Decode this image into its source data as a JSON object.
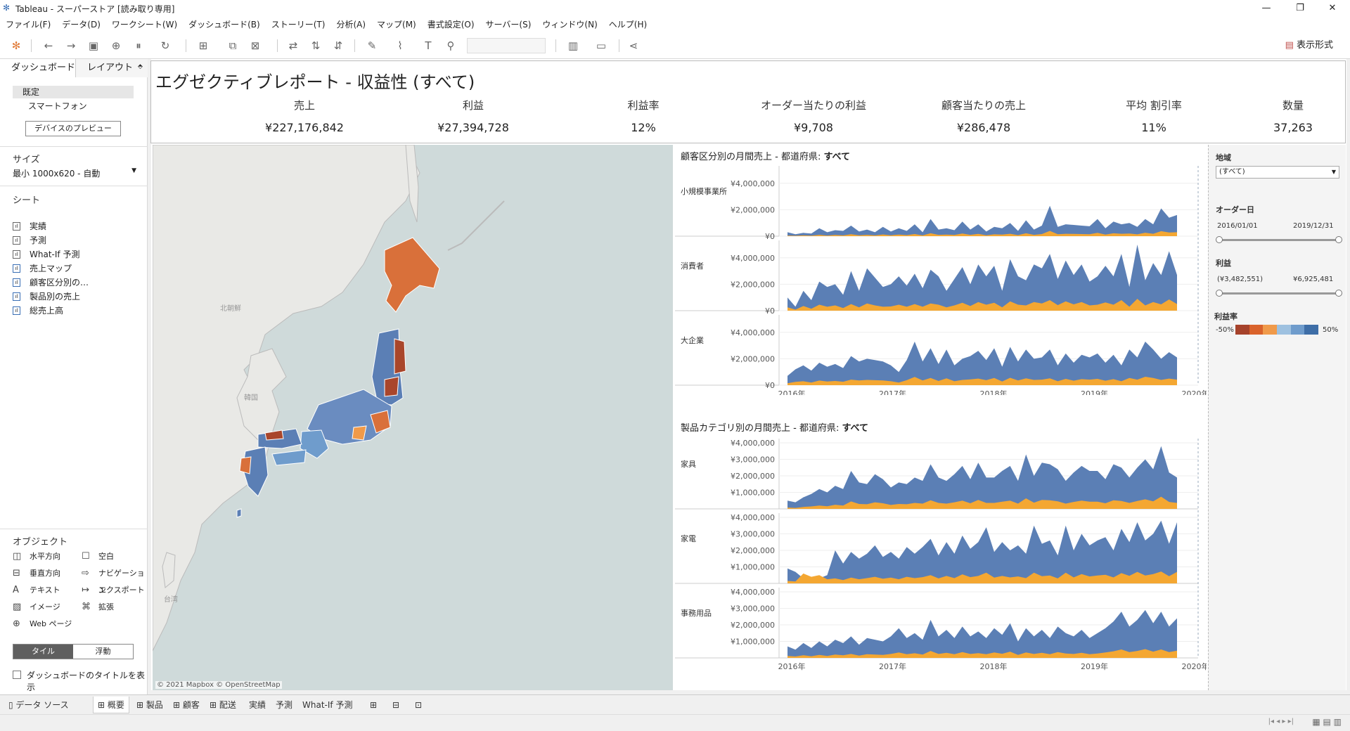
{
  "window": {
    "title": "Tableau - スーパーストア [読み取り専用]"
  },
  "menu": [
    "ファイル(F)",
    "データ(D)",
    "ワークシート(W)",
    "ダッシュボード(B)",
    "ストーリー(T)",
    "分析(A)",
    "マップ(M)",
    "書式設定(O)",
    "サーバー(S)",
    "ウィンドウ(N)",
    "ヘルプ(H)"
  ],
  "toolbar": {
    "show_me": "表示形式"
  },
  "left_pane": {
    "tabs": [
      "ダッシュボード",
      "レイアウト"
    ],
    "device_default": "既定",
    "device_phone": "スマートフォン",
    "device_preview_button": "デバイスのプレビュー",
    "size_label": "サイズ",
    "size_value": "最小 1000x620 - 自動",
    "sheets_label": "シート",
    "sheets": [
      "実績",
      "予測",
      "What-If 予測",
      "売上マップ",
      "顧客区分別の…",
      "製品別の売上",
      "総売上高"
    ],
    "objects_label": "オブジェクト",
    "objects": [
      {
        "label": "水平方向",
        "icon": "horizontal-container-icon"
      },
      {
        "label": "空白",
        "icon": "blank-icon"
      },
      {
        "label": "垂直方向",
        "icon": "vertical-container-icon"
      },
      {
        "label": "ナビゲーション",
        "icon": "navigation-icon"
      },
      {
        "label": "テキスト",
        "icon": "text-icon"
      },
      {
        "label": "エクスポート",
        "icon": "export-icon"
      },
      {
        "label": "イメージ",
        "icon": "image-icon"
      },
      {
        "label": "拡張",
        "icon": "extension-icon"
      },
      {
        "label": "Web ページ",
        "icon": "web-page-icon"
      }
    ],
    "tile_label": "タイル",
    "float_label": "浮動",
    "show_title_label": "ダッシュボードのタイトルを表示"
  },
  "dashboard": {
    "title": "エグゼクティブレポート - 収益性 (すべて)",
    "kpis": [
      {
        "label": "売上",
        "value": "¥227,176,842"
      },
      {
        "label": "利益",
        "value": "¥27,394,728"
      },
      {
        "label": "利益率",
        "value": "12%"
      },
      {
        "label": "オーダー当たりの利益",
        "value": "¥9,708"
      },
      {
        "label": "顧客当たりの売上",
        "value": "¥286,478"
      },
      {
        "label": "平均 割引率",
        "value": "11%"
      },
      {
        "label": "数量",
        "value": "37,263"
      }
    ],
    "map": {
      "copyright": "© 2021 Mapbox © OpenStreetMap",
      "labels": [
        "北朝鮮",
        "韓国",
        "台湾"
      ]
    }
  },
  "chart_data": [
    {
      "type": "area",
      "title_prefix": "顧客区分別の月間売上 - 都道府県: ",
      "title_bold": "すべて",
      "x_ticks": [
        "2016年",
        "2017年",
        "2018年",
        "2019年",
        "2020年"
      ],
      "y_ticks": [
        "¥4,000,000",
        "¥2,000,000",
        "¥0"
      ],
      "ylim": [
        0,
        5000000
      ],
      "series": [
        {
          "name": "小規模事業所",
          "sales": [
            300000,
            150000,
            250000,
            200000,
            600000,
            300000,
            450000,
            400000,
            800000,
            350000,
            500000,
            300000,
            700000,
            350000,
            600000,
            400000,
            900000,
            300000,
            1300000,
            500000,
            600000,
            450000,
            1100000,
            500000,
            900000,
            350000,
            700000,
            600000,
            1000000,
            400000,
            1200000,
            500000,
            800000,
            2300000,
            700000,
            900000,
            850000,
            800000,
            750000,
            1300000,
            600000,
            1100000,
            900000,
            1000000,
            700000,
            1300000,
            900000,
            2100000,
            1400000,
            1600000
          ],
          "profit": [
            50000,
            30000,
            60000,
            40000,
            100000,
            50000,
            90000,
            60000,
            150000,
            70000,
            100000,
            60000,
            130000,
            70000,
            120000,
            80000,
            160000,
            60000,
            220000,
            100000,
            120000,
            90000,
            200000,
            100000,
            170000,
            70000,
            140000,
            120000,
            180000,
            80000,
            220000,
            100000,
            160000,
            400000,
            150000,
            180000,
            170000,
            160000,
            150000,
            250000,
            120000,
            220000,
            180000,
            200000,
            140000,
            260000,
            180000,
            380000,
            280000,
            300000
          ]
        },
        {
          "name": "消費者",
          "sales": [
            1000000,
            300000,
            1500000,
            800000,
            2200000,
            1800000,
            2000000,
            1200000,
            3000000,
            1500000,
            3200000,
            2500000,
            1800000,
            2000000,
            2600000,
            1900000,
            2800000,
            1700000,
            3100000,
            2600000,
            1500000,
            2400000,
            3300000,
            2000000,
            3500000,
            2600000,
            3400000,
            1500000,
            3900000,
            2600000,
            2300000,
            3500000,
            3200000,
            4300000,
            2400000,
            3800000,
            2700000,
            3500000,
            2200000,
            2600000,
            3400000,
            2600000,
            4300000,
            1800000,
            5000000,
            2300000,
            3600000,
            2700000,
            4500000,
            2700000
          ],
          "profit": [
            250000,
            80000,
            350000,
            150000,
            450000,
            300000,
            400000,
            200000,
            500000,
            250000,
            550000,
            400000,
            300000,
            320000,
            450000,
            300000,
            500000,
            300000,
            550000,
            450000,
            250000,
            400000,
            600000,
            350000,
            650000,
            450000,
            600000,
            250000,
            700000,
            450000,
            400000,
            650000,
            550000,
            800000,
            420000,
            700000,
            480000,
            650000,
            400000,
            450000,
            620000,
            450000,
            800000,
            300000,
            900000,
            400000,
            650000,
            480000,
            850000,
            500000
          ]
        },
        {
          "name": "大企業",
          "sales": [
            700000,
            1200000,
            1500000,
            1100000,
            1700000,
            1400000,
            1600000,
            1300000,
            2200000,
            1800000,
            2000000,
            1900000,
            1800000,
            1500000,
            1000000,
            1900000,
            3300000,
            1800000,
            2800000,
            1600000,
            2700000,
            1500000,
            2000000,
            2200000,
            2600000,
            1900000,
            2800000,
            1400000,
            2900000,
            1800000,
            2700000,
            2000000,
            2100000,
            2700000,
            1500000,
            2400000,
            1700000,
            2300000,
            2100000,
            2400000,
            1700000,
            2300000,
            1500000,
            2700000,
            2100000,
            3300000,
            2700000,
            2000000,
            2500000,
            2100000
          ],
          "profit": [
            150000,
            250000,
            300000,
            200000,
            350000,
            280000,
            320000,
            260000,
            420000,
            360000,
            400000,
            380000,
            360000,
            300000,
            200000,
            380000,
            620000,
            360000,
            540000,
            320000,
            520000,
            300000,
            400000,
            440000,
            500000,
            380000,
            540000,
            280000,
            560000,
            360000,
            520000,
            400000,
            420000,
            520000,
            300000,
            480000,
            340000,
            460000,
            420000,
            480000,
            340000,
            460000,
            300000,
            540000,
            420000,
            640000,
            540000,
            400000,
            500000,
            420000
          ]
        }
      ]
    },
    {
      "type": "area",
      "title_prefix": "製品カテゴリ別の月間売上 - 都道府県: ",
      "title_bold": "すべて",
      "x_ticks": [
        "2016年",
        "2017年",
        "2018年",
        "2019年",
        "2020年"
      ],
      "y_ticks": [
        "¥4,000,000",
        "¥3,000,000",
        "¥2,000,000",
        "¥1,000,000"
      ],
      "ylim": [
        0,
        4000000
      ],
      "series": [
        {
          "name": "家具",
          "sales": [
            500000,
            400000,
            700000,
            900000,
            1200000,
            1000000,
            1400000,
            1200000,
            2300000,
            1600000,
            1500000,
            2100000,
            1800000,
            1300000,
            1600000,
            1500000,
            1900000,
            1700000,
            2700000,
            1900000,
            1700000,
            2100000,
            2600000,
            1800000,
            2800000,
            1900000,
            1900000,
            2300000,
            2600000,
            1700000,
            3300000,
            2000000,
            2800000,
            2700000,
            2400000,
            1700000,
            2200000,
            2600000,
            2300000,
            2300000,
            1800000,
            2700000,
            2500000,
            1900000,
            2500000,
            3000000,
            2400000,
            3800000,
            2200000,
            1900000
          ],
          "profit": [
            80000,
            60000,
            120000,
            150000,
            200000,
            160000,
            250000,
            200000,
            450000,
            300000,
            280000,
            400000,
            340000,
            240000,
            300000,
            280000,
            360000,
            320000,
            520000,
            360000,
            320000,
            400000,
            500000,
            340000,
            540000,
            360000,
            360000,
            440000,
            500000,
            320000,
            640000,
            380000,
            540000,
            520000,
            460000,
            320000,
            420000,
            500000,
            440000,
            440000,
            340000,
            520000,
            480000,
            360000,
            480000,
            580000,
            460000,
            740000,
            420000,
            360000
          ]
        },
        {
          "name": "家電",
          "sales": [
            900000,
            700000,
            300000,
            350000,
            300000,
            500000,
            2000000,
            1200000,
            1900000,
            1500000,
            1800000,
            2300000,
            1600000,
            1900000,
            1500000,
            2200000,
            1800000,
            2200000,
            2700000,
            1700000,
            2500000,
            1800000,
            2900000,
            2100000,
            2500000,
            3400000,
            1900000,
            2500000,
            2000000,
            2300000,
            1800000,
            3500000,
            2400000,
            2600000,
            1700000,
            3500000,
            2000000,
            3000000,
            2300000,
            2600000,
            2800000,
            2000000,
            3300000,
            2500000,
            3700000,
            2600000,
            3000000,
            3800000,
            2400000,
            3700000
          ],
          "profit": [
            150000,
            120000,
            600000,
            400000,
            500000,
            250000,
            300000,
            200000,
            350000,
            250000,
            320000,
            400000,
            280000,
            350000,
            250000,
            400000,
            320000,
            380000,
            500000,
            300000,
            450000,
            320000,
            550000,
            380000,
            450000,
            650000,
            350000,
            450000,
            360000,
            420000,
            320000,
            650000,
            440000,
            480000,
            300000,
            650000,
            360000,
            560000,
            420000,
            480000,
            520000,
            360000,
            620000,
            460000,
            700000,
            480000,
            560000,
            720000,
            440000,
            700000
          ]
        },
        {
          "name": "事務用品",
          "sales": [
            700000,
            500000,
            900000,
            600000,
            1000000,
            700000,
            1100000,
            900000,
            1300000,
            800000,
            1200000,
            1100000,
            1000000,
            1300000,
            1800000,
            1200000,
            1500000,
            1100000,
            2300000,
            1300000,
            1700000,
            1200000,
            1900000,
            1300000,
            1600000,
            1200000,
            1800000,
            1400000,
            2100000,
            1000000,
            1800000,
            1300000,
            1700000,
            1200000,
            1900000,
            1500000,
            1300000,
            1700000,
            1200000,
            1500000,
            1800000,
            2200000,
            2800000,
            1900000,
            2300000,
            2900000,
            2100000,
            2800000,
            1900000,
            2400000
          ],
          "profit": [
            120000,
            90000,
            160000,
            100000,
            180000,
            120000,
            200000,
            160000,
            240000,
            140000,
            220000,
            200000,
            180000,
            240000,
            330000,
            220000,
            280000,
            200000,
            420000,
            240000,
            310000,
            220000,
            350000,
            240000,
            290000,
            220000,
            330000,
            250000,
            380000,
            180000,
            330000,
            240000,
            310000,
            220000,
            350000,
            270000,
            240000,
            310000,
            220000,
            270000,
            330000,
            400000,
            510000,
            350000,
            420000,
            530000,
            380000,
            510000,
            350000,
            440000
          ]
        }
      ]
    }
  ],
  "filters": {
    "region_label": "地域",
    "region_value": "(すべて)",
    "order_date_label": "オーダー日",
    "order_date_start": "2016/01/01",
    "order_date_end": "2019/12/31",
    "profit_label": "利益",
    "profit_min": "(¥3,482,551)",
    "profit_max": "¥6,925,481",
    "margin_label": "利益率",
    "margin_min": "-50%",
    "margin_max": "50%",
    "margin_colors": [
      "#a6422b",
      "#d9622b",
      "#f09a4a",
      "#9ec1e0",
      "#6f9ccc",
      "#3e6ea7"
    ]
  },
  "status_tabs": [
    "データ ソース",
    "概要",
    "製品",
    "顧客",
    "配送",
    "実績",
    "予測",
    "What-If 予測"
  ],
  "colors": {
    "series_sales": "#5b7fb5",
    "series_profit": "#f4a732"
  }
}
